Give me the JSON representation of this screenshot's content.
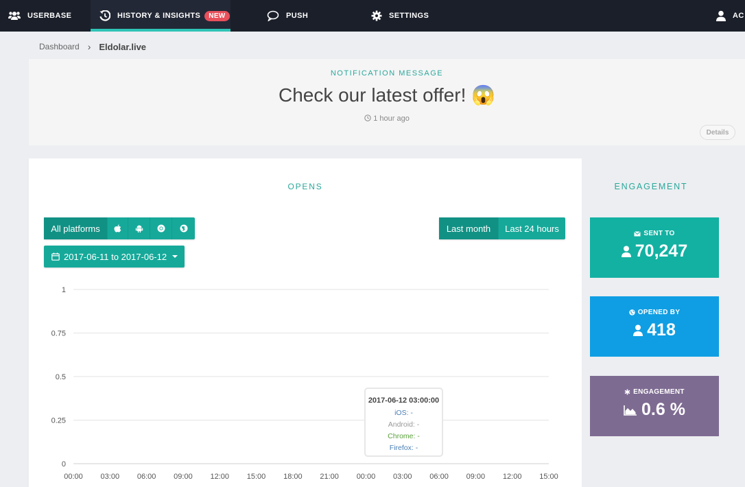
{
  "nav": {
    "userbase": "USERBASE",
    "history": "HISTORY & INSIGHTS",
    "history_badge": "NEW",
    "push": "PUSH",
    "settings": "SETTINGS",
    "account": "AC"
  },
  "breadcrumb": {
    "root": "Dashboard",
    "separator": "›",
    "current": "Eldolar.live"
  },
  "notification": {
    "label": "NOTIFICATION MESSAGE",
    "title": "Check our latest offer! 😱",
    "time": "1 hour ago",
    "details_label": "Details"
  },
  "opens": {
    "title": "OPENS",
    "platforms": {
      "all_label": "All platforms"
    },
    "range_buttons": {
      "last_month": "Last month",
      "last_24h": "Last 24 hours"
    },
    "date_range": "2017-06-11 to 2017-06-12"
  },
  "tooltip": {
    "title": "2017-06-12 03:00:00",
    "ios": "iOS: -",
    "android": "Android: -",
    "chrome": "Chrome: -",
    "firefox": "Firefox: -"
  },
  "engagement": {
    "title": "ENGAGEMENT",
    "sent_label": "SENT TO",
    "sent_value": "70,247",
    "opened_label": "OPENED BY",
    "opened_value": "418",
    "engagement_label": "ENGAGEMENT",
    "engagement_value": "0.6 %"
  },
  "colors": {
    "accent": "#16a99a",
    "sent": "#13b1a2",
    "opened": "#0f9ee3",
    "engagement": "#7e6b92",
    "ios": "#4a7fb5",
    "android": "#999999",
    "chrome": "#5aa13c",
    "firefox": "#4a7fb5"
  },
  "chart_data": {
    "type": "line",
    "x": [
      "00:00",
      "03:00",
      "06:00",
      "09:00",
      "12:00",
      "15:00",
      "18:00",
      "21:00",
      "00:00",
      "03:00",
      "06:00",
      "09:00",
      "12:00",
      "15:00"
    ],
    "y_ticks": [
      "1",
      "0.75",
      "0.5",
      "0.25",
      "0"
    ],
    "ylim": [
      0,
      1
    ],
    "grid": true,
    "series": []
  }
}
